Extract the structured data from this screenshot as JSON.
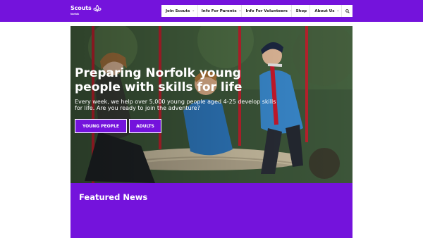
{
  "brand": {
    "name": "Scouts",
    "region": "Norfolk",
    "accent": "#7413dc"
  },
  "nav": {
    "items": [
      {
        "label": "Join Scouts",
        "dropdown": true
      },
      {
        "label": "Info For Parents",
        "dropdown": true
      },
      {
        "label": "Info For Volunteers",
        "dropdown": true
      },
      {
        "label": "Shop",
        "dropdown": false
      },
      {
        "label": "About Us",
        "dropdown": true
      }
    ],
    "search_icon": "search-icon",
    "chevron_icon": "chevron-down-icon"
  },
  "hero": {
    "title": "Preparing Norfolk young people with skills for life",
    "subtitle": "Every week, we help over 5,000 young people aged 4-25 develop skills for life. Are you ready to join the adventure?",
    "buttons": {
      "young_people": "YOUNG PEOPLE",
      "adults": "ADULTS"
    }
  },
  "featured": {
    "heading": "Featured News"
  }
}
